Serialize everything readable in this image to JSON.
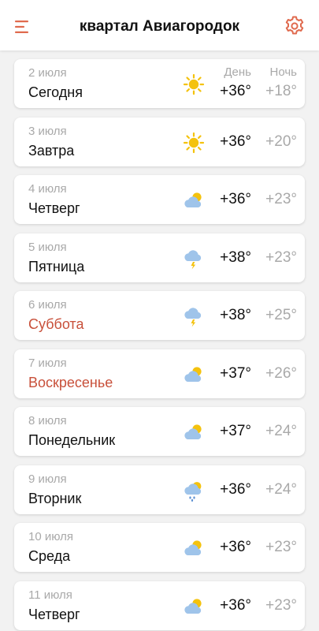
{
  "header": {
    "title": "квартал Авиагородок",
    "menu_icon": "hamburger-menu-icon",
    "settings_icon": "gear-icon",
    "accent_color": "#e06a4e"
  },
  "columns": {
    "day_label": "День",
    "night_label": "Ночь"
  },
  "colors": {
    "weekend": "#c8503a",
    "muted": "#a9a9a9",
    "text": "#111111"
  },
  "forecast": [
    {
      "date": "2 июля",
      "day": "Сегодня",
      "icon": "sun-icon",
      "t_day": "+36°",
      "t_night": "+18°",
      "weekend": false
    },
    {
      "date": "3 июля",
      "day": "Завтра",
      "icon": "sun-icon",
      "t_day": "+36°",
      "t_night": "+20°",
      "weekend": false
    },
    {
      "date": "4 июля",
      "day": "Четверг",
      "icon": "partly-cloudy-icon",
      "t_day": "+36°",
      "t_night": "+23°",
      "weekend": false
    },
    {
      "date": "5 июля",
      "day": "Пятница",
      "icon": "thunderstorm-icon",
      "t_day": "+38°",
      "t_night": "+23°",
      "weekend": false
    },
    {
      "date": "6 июля",
      "day": "Суббота",
      "icon": "thunderstorm-icon",
      "t_day": "+38°",
      "t_night": "+25°",
      "weekend": true
    },
    {
      "date": "7 июля",
      "day": "Воскресенье",
      "icon": "partly-cloudy-icon",
      "t_day": "+37°",
      "t_night": "+26°",
      "weekend": true
    },
    {
      "date": "8 июля",
      "day": "Понедельник",
      "icon": "partly-cloudy-icon",
      "t_day": "+37°",
      "t_night": "+24°",
      "weekend": false
    },
    {
      "date": "9 июля",
      "day": "Вторник",
      "icon": "sun-rain-icon",
      "t_day": "+36°",
      "t_night": "+24°",
      "weekend": false
    },
    {
      "date": "10 июля",
      "day": "Среда",
      "icon": "partly-cloudy-icon",
      "t_day": "+36°",
      "t_night": "+23°",
      "weekend": false
    },
    {
      "date": "11 июля",
      "day": "Четверг",
      "icon": "partly-cloudy-icon",
      "t_day": "+36°",
      "t_night": "+23°",
      "weekend": false
    }
  ]
}
